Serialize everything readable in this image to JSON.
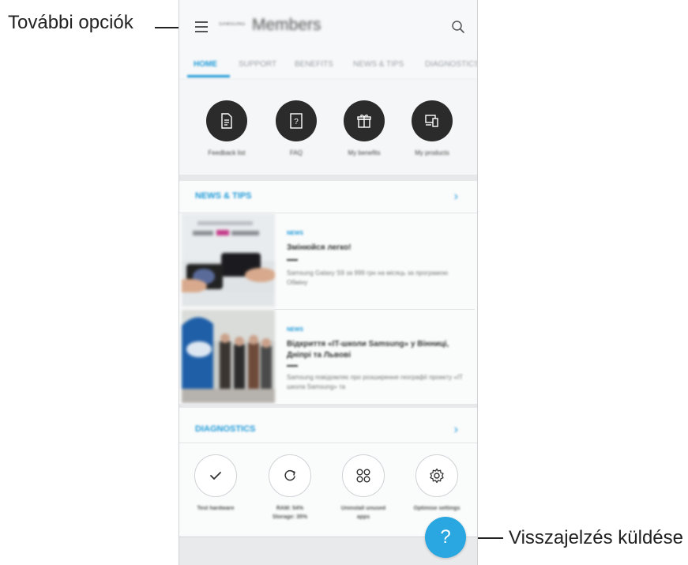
{
  "callouts": {
    "more_options": "További opciók",
    "send_feedback": "Visszajelzés küldése"
  },
  "app": {
    "subtitle": "SAMSUNG",
    "title": "Members"
  },
  "tabs": [
    {
      "label": "HOME",
      "active": true
    },
    {
      "label": "SUPPORT",
      "active": false
    },
    {
      "label": "BENEFITS",
      "active": false
    },
    {
      "label": "NEWS & TIPS",
      "active": false
    },
    {
      "label": "DIAGNOSTICS",
      "active": false
    }
  ],
  "quick_actions": [
    {
      "label": "Feedback list",
      "icon": "document-icon"
    },
    {
      "label": "FAQ",
      "icon": "question-doc-icon"
    },
    {
      "label": "My benefits",
      "icon": "gift-icon"
    },
    {
      "label": "My products",
      "icon": "devices-icon"
    }
  ],
  "news_section": {
    "title": "NEWS & TIPS",
    "items": [
      {
        "tag": "NEWS",
        "title": "Змінюйся легко!",
        "desc": "Samsung Galaxy S9 за 999 грн на місяць за програмою Обмiну",
        "thumb_text": "за 999 грн/міс"
      },
      {
        "tag": "NEWS",
        "title": "Відкриття «IT-школи Samsung» у Вінниці, Дніпрі та Львові",
        "desc": "Samsung повідомляє про розширення географії проекту «IT школа Samsung» та"
      }
    ]
  },
  "diagnostics_section": {
    "title": "DIAGNOSTICS",
    "items": [
      {
        "label": "Test hardware",
        "icon": "check-icon"
      },
      {
        "label": "RAM: 54% Storage: 35%",
        "icon": "refresh-icon"
      },
      {
        "label": "Uninstall unused apps",
        "icon": "apps-grid-icon"
      },
      {
        "label": "Optimise settings",
        "icon": "gear-icon"
      }
    ]
  },
  "fab": {
    "label": "?",
    "icon": "question-icon"
  },
  "colors": {
    "accent": "#1e9ad8",
    "fab": "#2aa7e0",
    "dark_circle": "#2b2b2b"
  }
}
